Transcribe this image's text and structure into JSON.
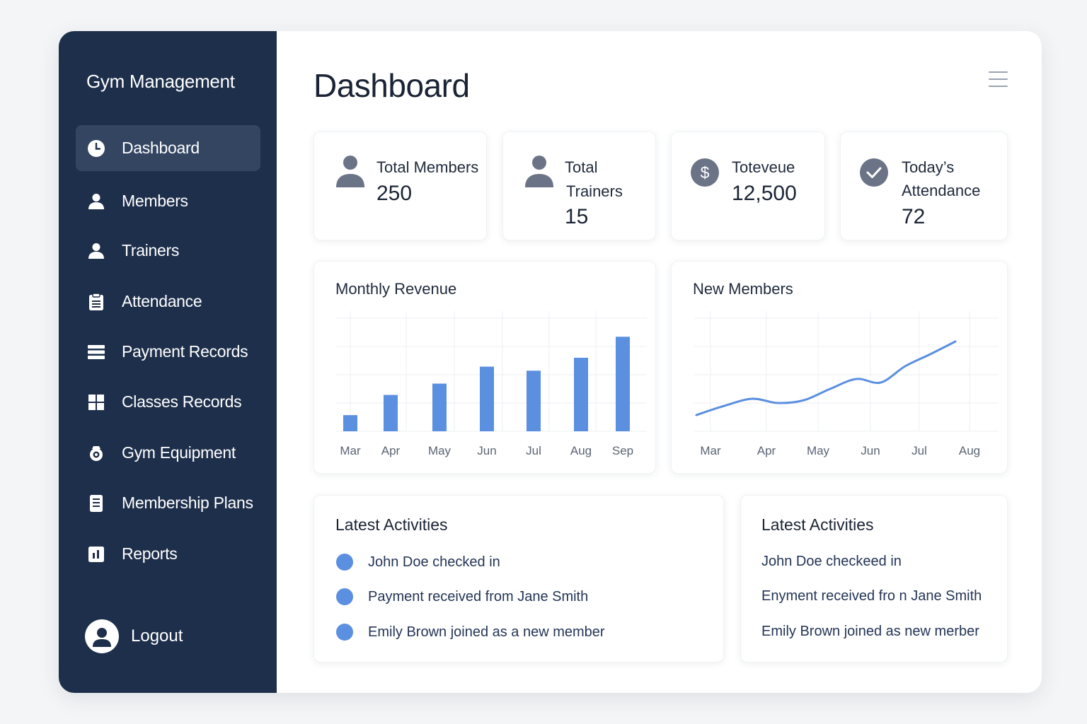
{
  "sidebar": {
    "brand": "Gym Management",
    "items": [
      {
        "label": "Dashboard",
        "icon": "clock-icon",
        "active": true
      },
      {
        "label": "Members",
        "icon": "user-icon",
        "active": false
      },
      {
        "label": "Trainers",
        "icon": "user-icon",
        "active": false
      },
      {
        "label": "Attendance",
        "icon": "clipboard-icon",
        "active": false
      },
      {
        "label": "Payment Records",
        "icon": "list-icon",
        "active": false
      },
      {
        "label": "Classes Records",
        "icon": "grid-icon",
        "active": false
      },
      {
        "label": "Gym Equipment",
        "icon": "equipment-icon",
        "active": false
      },
      {
        "label": "Membership Plans",
        "icon": "document-icon",
        "active": false
      },
      {
        "label": "Reports",
        "icon": "report-icon",
        "active": false
      }
    ],
    "logout_label": "Logout"
  },
  "header": {
    "title": "Dashboard",
    "menu_icon": "hamburger-menu-icon"
  },
  "stats": [
    {
      "label_lines": [
        "Total Members"
      ],
      "value": "250",
      "icon": "user-icon"
    },
    {
      "label_lines": [
        "Total",
        "Trainers"
      ],
      "value": "15",
      "icon": "user-icon"
    },
    {
      "label_lines": [
        "Toteveue"
      ],
      "value": "12,500",
      "icon": "dollar-circle-icon"
    },
    {
      "label_lines": [
        "Today’s",
        "Attendance"
      ],
      "value": "72",
      "icon": "check-circle-icon"
    }
  ],
  "colors": {
    "sidebar_bg": "#1e2f4b",
    "sidebar_active": "#334561",
    "accent_blue": "#5b8fe0",
    "icon_gray": "#6b7386"
  },
  "chart_data": [
    {
      "type": "bar",
      "title": "Monthly Revenue",
      "categories": [
        "Mar",
        "Apr",
        "May",
        "Jun",
        "Jul",
        "Aug",
        "Sep"
      ],
      "values": [
        2.0,
        4.5,
        5.9,
        8.0,
        7.5,
        9.1,
        11.7
      ],
      "ylim": [
        0,
        14
      ],
      "grid": true
    },
    {
      "type": "line",
      "title": "New Members",
      "categories": [
        "Mar",
        "Apr",
        "May",
        "Jun",
        "Jul",
        "Aug"
      ],
      "points": [
        [
          0,
          2.3
        ],
        [
          0.5,
          3.6
        ],
        [
          1,
          4.6
        ],
        [
          1.5,
          4.0
        ],
        [
          2,
          4.4
        ],
        [
          2.5,
          6.0
        ],
        [
          3,
          7.4
        ],
        [
          3.5,
          6.9
        ],
        [
          4,
          9.2
        ],
        [
          4.5,
          10.9
        ],
        [
          5,
          12.7
        ]
      ],
      "ylim": [
        0,
        16
      ],
      "grid": true
    }
  ],
  "activities_left": {
    "title": "Latest Activities",
    "items": [
      "John Doe checked in",
      "Payment received from Jane Smith",
      "Emily Brown joined as a new member"
    ]
  },
  "activities_right": {
    "title": "Latest Activities",
    "items": [
      "John Doe checkeed in",
      "Enyment received fro n Jane Smith",
      "Emily Brown joined as new merber"
    ]
  }
}
